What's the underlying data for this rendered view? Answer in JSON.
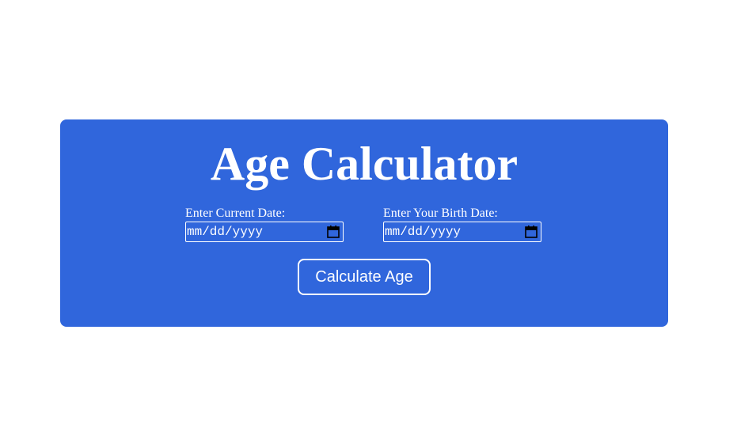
{
  "page": {
    "title": "Age Calculator",
    "accent_color": "#3066dc"
  },
  "form": {
    "current_date": {
      "label": "Enter Current Date:",
      "placeholder": "mm/dd/yyyy",
      "icon": "calendar-icon"
    },
    "birth_date": {
      "label": "Enter Your Birth Date:",
      "placeholder": "mm/dd/yyyy",
      "icon": "calendar-icon"
    },
    "submit_label": "Calculate Age"
  }
}
